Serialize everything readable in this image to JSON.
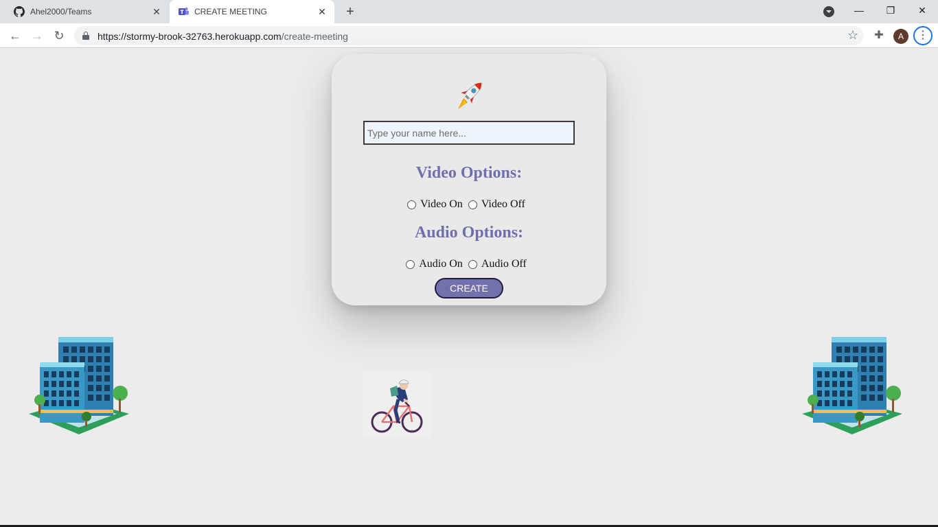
{
  "browser": {
    "tabs": [
      {
        "title": "Ahel2000/Teams",
        "favicon": "github-icon",
        "active": false
      },
      {
        "title": "CREATE MEETING",
        "favicon": "teams-icon",
        "active": true
      }
    ],
    "url_host": "https://stormy-brook-32763.herokuapp.com",
    "url_path": "/create-meeting",
    "avatar_letter": "A"
  },
  "form": {
    "name_placeholder": "Type your name here...",
    "video_title": "Video Options:",
    "video_on_label": "Video On",
    "video_off_label": "Video Off",
    "audio_title": "Audio Options:",
    "audio_on_label": "Audio On",
    "audio_off_label": "Audio Off",
    "create_label": "CREATE"
  },
  "colors": {
    "accent": "#7371ad",
    "heading": "#6f6fae",
    "page_background": "#ececec"
  }
}
